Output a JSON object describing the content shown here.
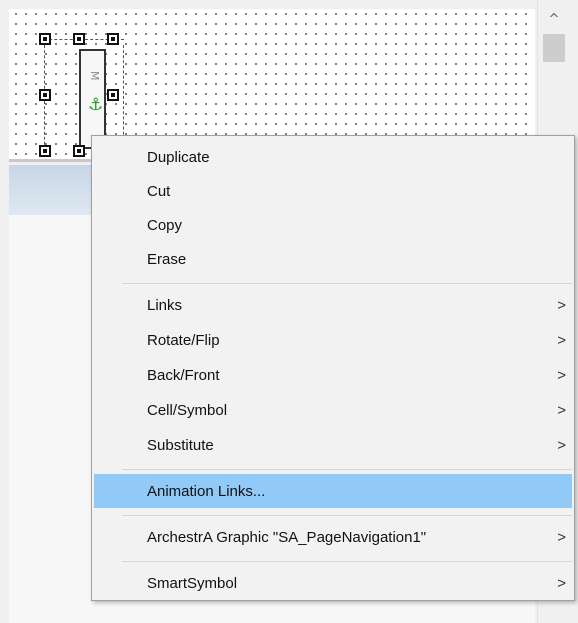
{
  "menu": {
    "items": [
      {
        "label": "Duplicate",
        "submenu": false
      },
      {
        "label": "Cut",
        "submenu": false
      },
      {
        "label": "Copy",
        "submenu": false
      },
      {
        "label": "Erase",
        "submenu": false
      },
      {
        "label": "Links",
        "submenu": true
      },
      {
        "label": "Rotate/Flip",
        "submenu": true
      },
      {
        "label": "Back/Front",
        "submenu": true
      },
      {
        "label": "Cell/Symbol",
        "submenu": true
      },
      {
        "label": "Substitute",
        "submenu": true
      },
      {
        "label": "Animation Links...",
        "submenu": false,
        "highlighted": true
      },
      {
        "label": "ArchestrA Graphic \"SA_PageNavigation1\"",
        "submenu": true
      },
      {
        "label": "SmartSymbol",
        "submenu": true
      }
    ],
    "submenu_glyph": ">"
  },
  "canvas": {
    "symbol_label": "M"
  },
  "scrollbar": {
    "up_glyph": "^"
  },
  "colors": {
    "highlight": "#91c9f7",
    "menu_bg": "#f2f2f2",
    "anchor": "#1f9a1f"
  }
}
